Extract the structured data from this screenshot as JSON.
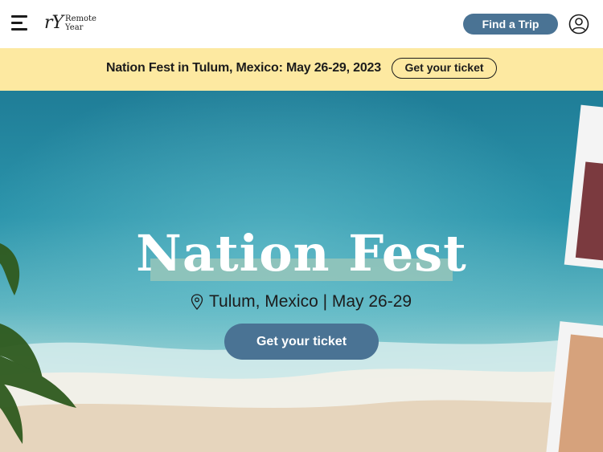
{
  "nav": {
    "logo_mark": "rY",
    "logo_line1": "Remote",
    "logo_line2": "Year",
    "find_trip_label": "Find a Trip"
  },
  "promo": {
    "text": "Nation Fest in Tulum, Mexico: May 26-29, 2023",
    "button_label": "Get your ticket"
  },
  "hero": {
    "title": "Nation Fest",
    "location": "Tulum, Mexico | May 26-29",
    "cta_label": "Get your ticket"
  },
  "colors": {
    "brand_blue": "#4a7394",
    "promo_yellow": "#fde9a1",
    "ocean": "#2b8fa6",
    "highlight": "#97c5ba"
  },
  "icons": {
    "menu": "hamburger-menu-icon",
    "account": "user-circle-icon",
    "location": "map-pin-icon"
  }
}
